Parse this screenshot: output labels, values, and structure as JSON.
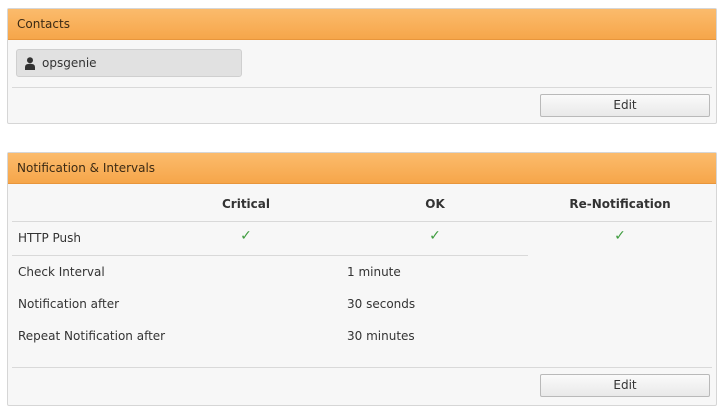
{
  "contacts_panel": {
    "title": "Contacts",
    "contact": {
      "name": "opsgenie",
      "icon": "person-icon"
    },
    "edit_label": "Edit"
  },
  "notification_panel": {
    "title": "Notification & Intervals",
    "columns": [
      "Critical",
      "OK",
      "Re-Notification"
    ],
    "http_push": {
      "label": "HTTP Push",
      "critical": "✓",
      "ok": "✓",
      "renotification": "✓"
    },
    "intervals": [
      {
        "label": "Check Interval",
        "value": "1 minute"
      },
      {
        "label": "Notification after",
        "value": "30 seconds"
      },
      {
        "label": "Repeat Notification after",
        "value": "30 minutes"
      }
    ],
    "edit_label": "Edit"
  },
  "colors": {
    "header_orange": "#f6a64a",
    "check_green": "#3f9c3f"
  }
}
